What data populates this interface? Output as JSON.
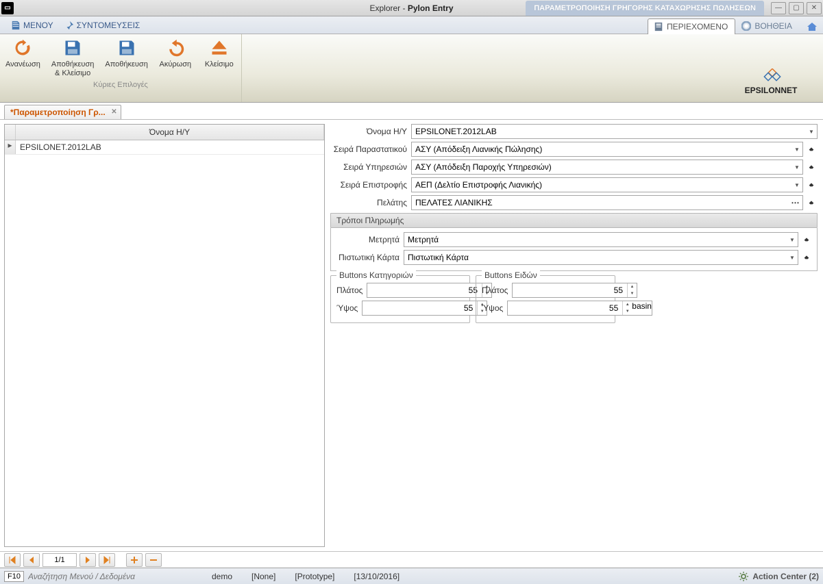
{
  "title_bar": {
    "explorer": "Explorer - ",
    "app": "Pylon Entry",
    "ribbon_tab": "ΠΑΡΑΜΕΤΡΟΠΟΙΗΣΗ ΓΡΗΓΟΡΗΣ ΚΑΤΑΧΩΡΗΣΗΣ ΠΩΛΗΣΕΩΝ"
  },
  "menu": {
    "main_menu": "ΜΕΝΟΥ",
    "shortcuts": "ΣΥΝΤΟΜΕΥΣΕΙΣ"
  },
  "tabs": {
    "content": "ΠΕΡΙΕΧΟΜΕΝΟ",
    "help": "ΒΟΗΘΕΙΑ"
  },
  "ribbon": {
    "refresh": "Ανανέωση",
    "save_close": "Αποθήκευση\n& Κλείσιμο",
    "save": "Αποθήκευση",
    "cancel": "Ακύρωση",
    "close": "Κλείσιμο",
    "group_label": "Κύριες Επιλογές"
  },
  "doc_tab": {
    "label": "*Παραμετροποίηση Γρ..."
  },
  "grid": {
    "header": "Όνομα Η/Υ",
    "rows": [
      "EPSILONET.2012LAB"
    ]
  },
  "form": {
    "name_label": "Όνομα Η/Υ",
    "name_value": "EPSILONET.2012LAB",
    "doc_series_label": "Σειρά Παραστατικού",
    "doc_series_value": "ΑΣΥ (Απόδειξη Λιανικής Πώλησης)",
    "svc_series_label": "Σειρά Υπηρεσιών",
    "svc_series_value": "ΑΣΥ (Απόδειξη Παροχής Υπηρεσιών)",
    "ret_series_label": "Σειρά Επιστροφής",
    "ret_series_value": "ΑΕΠ (Δελτίο Επιστροφής Λιανικής)",
    "customer_label": "Πελάτης",
    "customer_value": "ΠΕΛΑΤΕΣ ΛΙΑΝΙΚΗΣ"
  },
  "payment": {
    "header": "Τρόποι Πληρωμής",
    "cash_label": "Μετρητά",
    "cash_value": "Μετρητά",
    "card_label": "Πιστωτική Κάρτα",
    "card_value": "Πιστωτική Κάρτα"
  },
  "buttons_cat": {
    "title": "Buttons Κατηγοριών",
    "width_label": "Πλάτος",
    "width_value": "55",
    "height_label": "Ύψος",
    "height_value": "55"
  },
  "buttons_items": {
    "title": "Buttons Ειδών",
    "width_label": "Πλάτος",
    "width_value": "55",
    "height_label": "Ύψος",
    "height_value": "55"
  },
  "navigator": {
    "page": "1/1"
  },
  "status": {
    "f10": "F10",
    "search_placeholder": "Αναζήτηση Μενού / Δεδομένα",
    "segs": [
      "demo",
      "[None]",
      "[Prototype]",
      "[13/10/2016]"
    ],
    "action_center": "Action Center (2)"
  },
  "logo": {
    "text": "EPSILONNET"
  }
}
